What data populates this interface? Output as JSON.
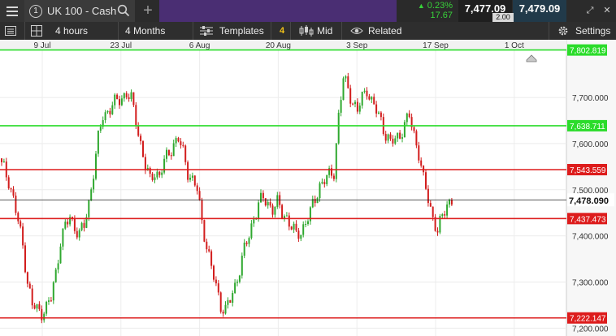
{
  "topbar": {
    "instrument_number": "1",
    "instrument_name": "UK 100 - Cash",
    "icons": [
      "menu-icon",
      "search-icon",
      "plus-icon",
      "restore-icon",
      "close-icon"
    ],
    "change_percent": "0.23%",
    "change_points": "17.67",
    "sell_price": "7,477.09",
    "buy_price": "7,479.09",
    "spread": "2.00",
    "colors": {
      "purple": "#4a2e73",
      "up": "#38d13a"
    }
  },
  "toolbar": {
    "interval": "4 hours",
    "range": "4 Months",
    "templates_label": "Templates",
    "indicator_count": "4",
    "price_type": "Mid",
    "related_label": "Related",
    "settings_label": "Settings",
    "icons": [
      "list-icon",
      "grid-icon",
      "templates-icon",
      "candles-icon",
      "eye-icon",
      "gear-icon"
    ]
  },
  "chart_data": {
    "type": "candlestick",
    "x_tick_labels": [
      "9 Jul",
      "23 Jul",
      "6 Aug",
      "20 Aug",
      "3 Sep",
      "17 Sep",
      "1 Oct"
    ],
    "y_tick_labels": [
      "7,700.000",
      "7,600.000",
      "7,500.000",
      "7,400.000",
      "7,300.000",
      "7,200.000"
    ],
    "y_ticks": [
      7700,
      7600,
      7500,
      7400,
      7300,
      7200
    ],
    "ylim": [
      7183,
      7825
    ],
    "grid": true,
    "current_price": {
      "value": 7478.09,
      "label": "7,478.090"
    },
    "horizontal_lines": [
      {
        "value": 7802.819,
        "label": "7,802.819",
        "color": "#2bdc2b"
      },
      {
        "value": 7638.711,
        "label": "7,638.711",
        "color": "#2bdc2b"
      },
      {
        "value": 7543.559,
        "label": "7,543.559",
        "color": "#dd1c1c"
      },
      {
        "value": 7437.473,
        "label": "7,437.473",
        "color": "#dd1c1c"
      },
      {
        "value": 7222.147,
        "label": "7,222.147",
        "color": "#dd1c1c"
      }
    ],
    "colors": {
      "up": "#2fa82f",
      "down": "#d21d1d"
    },
    "close_series": [
      7560,
      7545,
      7520,
      7480,
      7430,
      7380,
      7300,
      7250,
      7240,
      7235,
      7245,
      7265,
      7320,
      7390,
      7420,
      7440,
      7420,
      7405,
      7420,
      7470,
      7540,
      7610,
      7660,
      7670,
      7685,
      7690,
      7700,
      7710,
      7695,
      7650,
      7600,
      7550,
      7520,
      7540,
      7530,
      7560,
      7580,
      7600,
      7610,
      7580,
      7540,
      7520,
      7500,
      7430,
      7380,
      7330,
      7290,
      7250,
      7240,
      7260,
      7290,
      7330,
      7370,
      7400,
      7440,
      7470,
      7480,
      7470,
      7460,
      7470,
      7450,
      7440,
      7420,
      7400,
      7410,
      7430,
      7450,
      7480,
      7510,
      7520,
      7530,
      7540,
      7660,
      7740,
      7720,
      7690,
      7670,
      7700,
      7720,
      7690,
      7670,
      7650,
      7620,
      7600,
      7610,
      7620,
      7640,
      7660,
      7620,
      7580,
      7520,
      7480,
      7440,
      7410,
      7440,
      7470,
      7478
    ]
  }
}
